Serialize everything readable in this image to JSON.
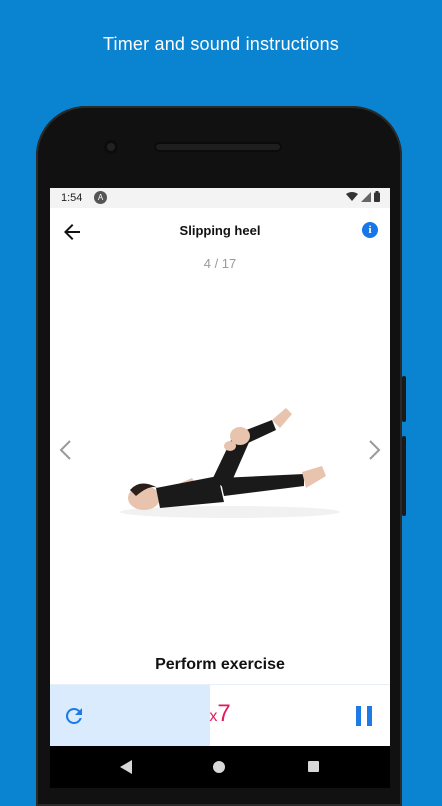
{
  "promo": {
    "caption": "Timer and sound instructions"
  },
  "status_bar": {
    "time": "1:54",
    "app_icon_letter": "A"
  },
  "app_bar": {
    "title": "Slipping heel",
    "info_symbol": "i"
  },
  "progress": {
    "counter": "4 / 17",
    "current": 4,
    "total": 17
  },
  "exercise": {
    "phase_label": "Perform exercise",
    "reps_prefix": "x",
    "reps_count": "7",
    "timer_fraction": 0.47
  },
  "colors": {
    "background": "#0a84d0",
    "accent": "#1e7be6",
    "reps": "#e8195a",
    "progress_fill": "#d9ebfd"
  },
  "icons": [
    "back-arrow-icon",
    "info-icon",
    "chevron-left-icon",
    "chevron-right-icon",
    "restart-icon",
    "pause-icon",
    "wifi-icon",
    "signal-icon",
    "battery-icon"
  ]
}
